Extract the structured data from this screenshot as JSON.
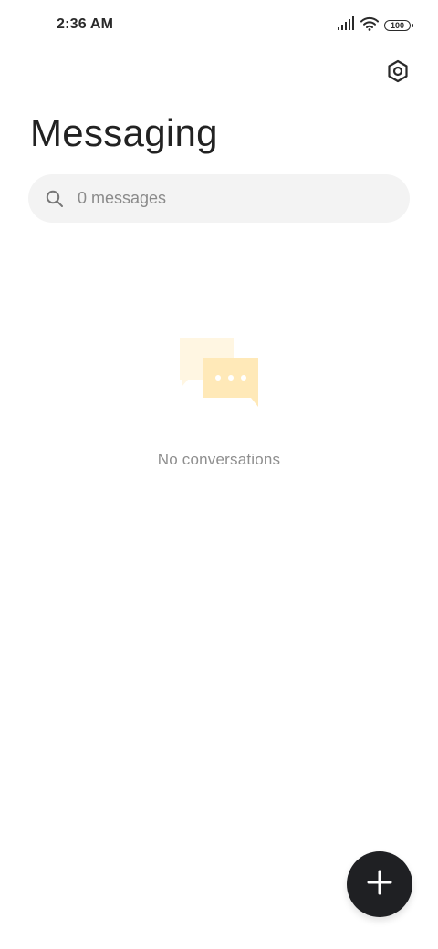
{
  "status_bar": {
    "time": "2:36 AM",
    "battery_level": "100"
  },
  "header": {
    "title": "Messaging",
    "settings_icon": "settings-icon"
  },
  "search": {
    "placeholder": "0 messages",
    "value": "",
    "icon": "search-icon"
  },
  "empty_state": {
    "icon": "chat-bubbles-icon",
    "message": "No conversations"
  },
  "fab": {
    "icon": "plus-icon"
  },
  "colors": {
    "background": "#ffffff",
    "fab": "#1f2023",
    "search_bg": "#f3f3f3",
    "illustration_light": "#fff6e0",
    "illustration_accent": "#ffe7b3"
  }
}
